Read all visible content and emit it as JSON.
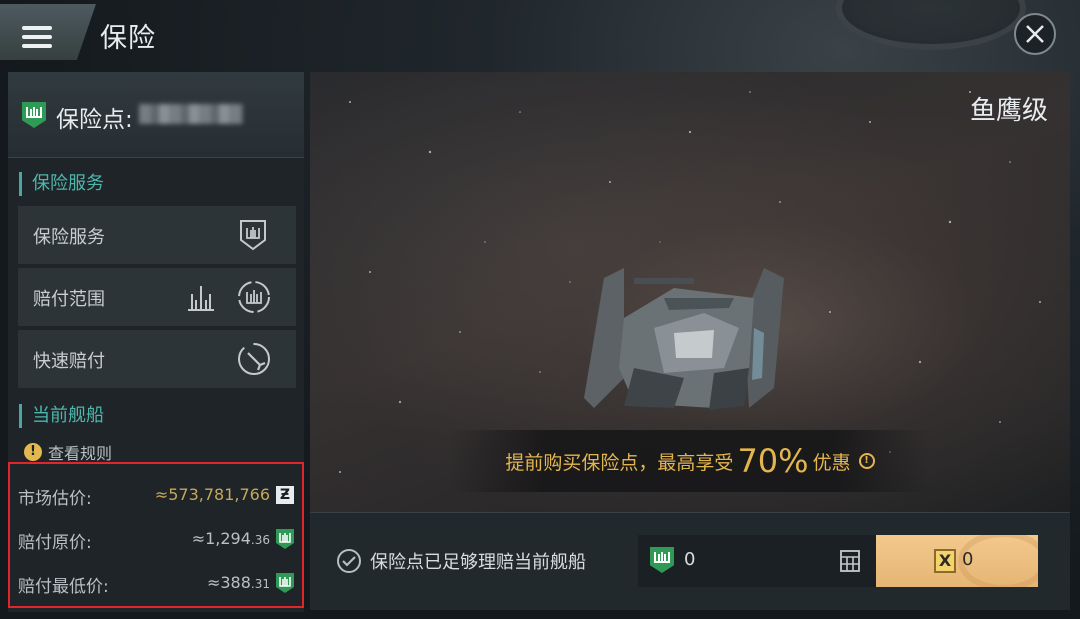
{
  "header": {
    "title": "保险",
    "menu_icon": "hamburger-menu-icon",
    "close_icon": "close-icon"
  },
  "sidebar": {
    "points_label": "保险点:",
    "points_value_obscured": true,
    "section_services": "保险服务",
    "services": [
      {
        "label": "保险服务",
        "icon": "shield-ship-icon"
      },
      {
        "label": "赔付范围",
        "icon": "coverage-scope-icon"
      },
      {
        "label": "快速赔付",
        "icon": "quick-payout-icon"
      }
    ],
    "section_current_ship": "当前舰船",
    "rules_label": "查看规则",
    "info": {
      "market_estimate_label": "市场估价:",
      "market_estimate_value": "≈573,781,766",
      "payout_original_label": "赔付原价:",
      "payout_original_main": "≈1,294",
      "payout_original_decimal": ".36",
      "payout_min_label": "赔付最低价:",
      "payout_min_main": "≈388",
      "payout_min_decimal": ".31"
    }
  },
  "view": {
    "ship_name": "鱼鹰级",
    "promo_prefix": "提前购买保险点，最高享受",
    "promo_percent": "70%",
    "promo_suffix": "优惠"
  },
  "bottom": {
    "sufficient_label": "保险点已足够理赔当前舰船",
    "points_input_value": "0",
    "buy_value": "0"
  },
  "colors": {
    "accent_teal": "#4fb6ab",
    "gold": "#e3b54e",
    "shield_green": "#2f9a55",
    "highlight_red": "#e2252b",
    "buy_button": "#eebf80"
  }
}
